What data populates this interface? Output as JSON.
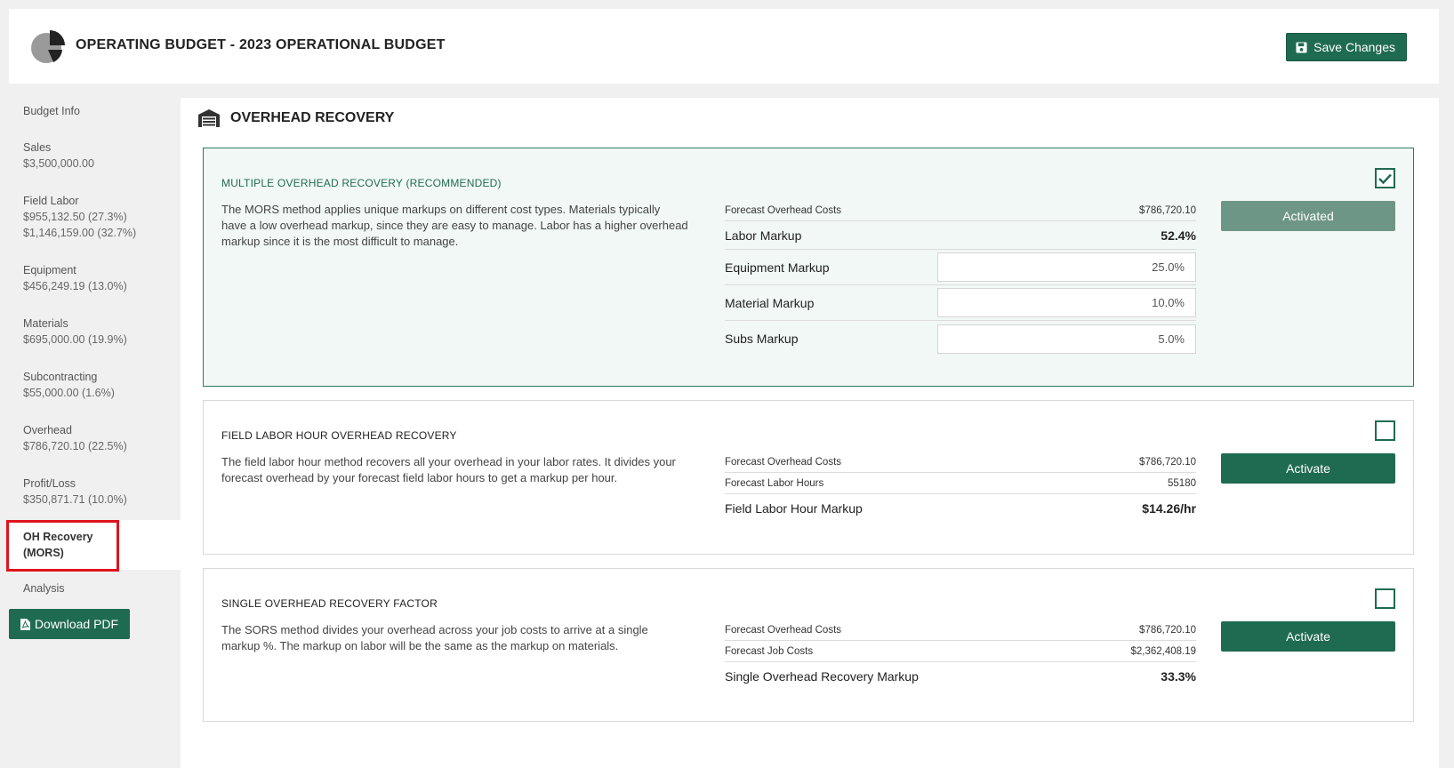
{
  "header": {
    "title": "OPERATING BUDGET - 2023 OPERATIONAL BUDGET",
    "save_label": "Save Changes"
  },
  "sidebar": {
    "items": [
      {
        "label": "Budget Info",
        "values": []
      },
      {
        "label": "Sales",
        "values": [
          "$3,500,000.00"
        ]
      },
      {
        "label": "Field Labor",
        "values": [
          "$955,132.50 (27.3%)",
          "$1,146,159.00 (32.7%)"
        ]
      },
      {
        "label": "Equipment",
        "values": [
          "$456,249.19 (13.0%)"
        ]
      },
      {
        "label": "Materials",
        "values": [
          "$695,000.00 (19.9%)"
        ]
      },
      {
        "label": "Subcontracting",
        "values": [
          "$55,000.00 (1.6%)"
        ]
      },
      {
        "label": "Overhead",
        "values": [
          "$786,720.10 (22.5%)"
        ]
      },
      {
        "label": "Profit/Loss",
        "values": [
          "$350,871.71 (10.0%)"
        ]
      },
      {
        "label": "OH Recovery (MORS)",
        "values": [],
        "active": true
      },
      {
        "label": "Analysis",
        "values": []
      }
    ],
    "download_label": "Download PDF"
  },
  "section": {
    "title": "OVERHEAD RECOVERY"
  },
  "cards": [
    {
      "title": "MULTIPLE OVERHEAD RECOVERY (RECOMMENDED)",
      "description": "The MORS method applies unique markups on different cost types. Materials typically have a low overhead markup, since they are easy to manage. Labor has a higher overhead markup since it is the most difficult to manage.",
      "checked": true,
      "button_label": "Activated",
      "rows": {
        "forecast_overhead_label": "Forecast Overhead Costs",
        "forecast_overhead_value": "$786,720.10",
        "labor_markup_label": "Labor Markup",
        "labor_markup_value": "52.4%",
        "equipment_markup_label": "Equipment Markup",
        "equipment_markup_value": "25.0%",
        "material_markup_label": "Material Markup",
        "material_markup_value": "10.0%",
        "subs_markup_label": "Subs Markup",
        "subs_markup_value": "5.0%"
      }
    },
    {
      "title": "FIELD LABOR HOUR OVERHEAD RECOVERY",
      "description": "The field labor hour method recovers all your overhead in your labor rates. It divides your forecast overhead by your forecast field labor hours to get a markup per hour.",
      "checked": false,
      "button_label": "Activate",
      "rows": {
        "forecast_overhead_label": "Forecast Overhead Costs",
        "forecast_overhead_value": "$786,720.10",
        "forecast_hours_label": "Forecast Labor Hours",
        "forecast_hours_value": "55180",
        "markup_label": "Field Labor Hour Markup",
        "markup_value": "$14.26/hr"
      }
    },
    {
      "title": "SINGLE OVERHEAD RECOVERY FACTOR",
      "description": "The SORS method divides your overhead across your job costs to arrive at a single markup %. The markup on labor will be the same as the markup on materials.",
      "checked": false,
      "button_label": "Activate",
      "rows": {
        "forecast_overhead_label": "Forecast Overhead Costs",
        "forecast_overhead_value": "$786,720.10",
        "forecast_job_label": "Forecast Job Costs",
        "forecast_job_value": "$2,362,408.19",
        "markup_label": "Single Overhead Recovery Markup",
        "markup_value": "33.3%"
      }
    }
  ],
  "colors": {
    "accent": "#1f6b52",
    "activated": "#6e9686",
    "highlight": "#e0121b"
  }
}
